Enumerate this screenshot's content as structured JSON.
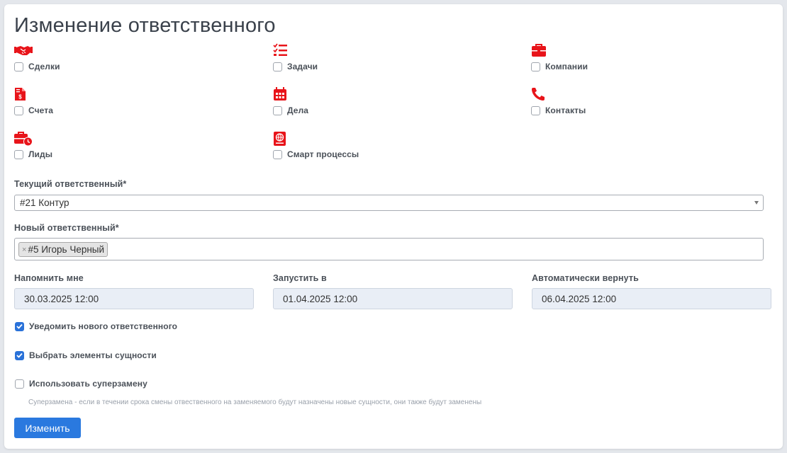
{
  "page": {
    "title": "Изменение ответственного"
  },
  "colors": {
    "icon": "#e8141a",
    "accent": "#2a79df",
    "checkbox_checked": "#2a72d9"
  },
  "entities": [
    {
      "label": "Сделки",
      "icon": "handshake-icon",
      "checked": false
    },
    {
      "label": "Задачи",
      "icon": "task-list-icon",
      "checked": false
    },
    {
      "label": "Компании",
      "icon": "briefcase-icon",
      "checked": false
    },
    {
      "label": "Счета",
      "icon": "invoice-icon",
      "checked": false
    },
    {
      "label": "Дела",
      "icon": "calendar-icon",
      "checked": false
    },
    {
      "label": "Контакты",
      "icon": "phone-icon",
      "checked": false
    },
    {
      "label": "Лиды",
      "icon": "briefcase-clock-icon",
      "checked": false
    },
    {
      "label": "Смарт процессы",
      "icon": "globe-book-icon",
      "checked": false
    }
  ],
  "current_responsible": {
    "label": "Текущий ответственный*",
    "value": "#21 Контур"
  },
  "new_responsible": {
    "label": "Новый ответственный*",
    "tags": [
      "#5 Игорь Черный"
    ],
    "remove_glyph": "×"
  },
  "dates": {
    "remind": {
      "label": "Напомнить мне",
      "value": "30.03.2025 12:00"
    },
    "start": {
      "label": "Запустить в",
      "value": "01.04.2025 12:00"
    },
    "auto_return": {
      "label": "Автоматически вернуть",
      "value": "06.04.2025 12:00"
    }
  },
  "options": {
    "notify": {
      "label": "Уведомить нового ответственного",
      "checked": true
    },
    "select_elements": {
      "label": "Выбрать элементы сущности",
      "checked": true
    },
    "super_replace": {
      "label": "Использовать суперзамену",
      "checked": false
    }
  },
  "hint": "Суперзамена - если в течении срока смены отвественного на заменяемого будут назначены новые сущности, они также будут заменены",
  "submit": {
    "label": "Изменить"
  }
}
